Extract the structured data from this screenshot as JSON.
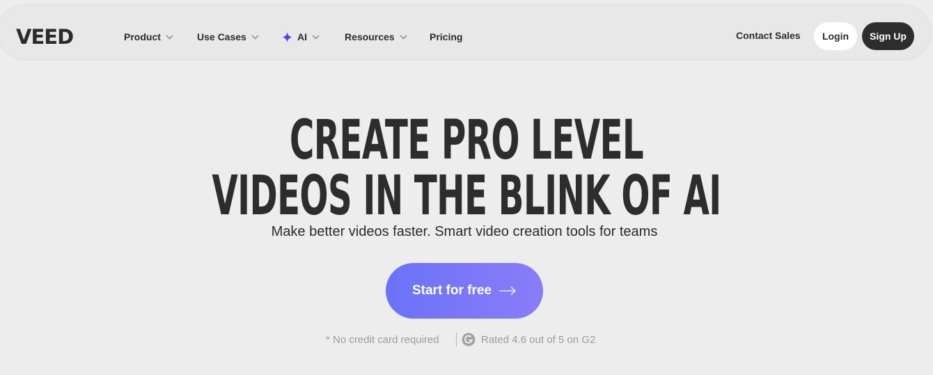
{
  "brand": {
    "logo_text": "VEED"
  },
  "nav": {
    "items": [
      {
        "label": "Product",
        "icon": "chevron-down-icon"
      },
      {
        "label": "Use Cases",
        "icon": "chevron-down-icon"
      },
      {
        "label": "AI",
        "icon": "sparkle-icon",
        "accent": "#4f46e5"
      },
      {
        "label": "Resources",
        "icon": "chevron-down-icon"
      },
      {
        "label": "Pricing"
      }
    ],
    "contact_label": "Contact Sales",
    "login_label": "Login",
    "signup_label": "Sign Up"
  },
  "hero": {
    "title_line1": "CREATE PRO LEVEL",
    "title_line2": "VIDEOS IN THE BLINK OF AI",
    "subtitle": "Make better videos faster. Smart video creation tools for teams",
    "cta_label": "Start for free",
    "cta_colors": [
      "#6b72f7",
      "#8a7cf8"
    ],
    "note_left": "* No credit card required",
    "note_right": "Rated 4.6 out of 5 on G2"
  }
}
